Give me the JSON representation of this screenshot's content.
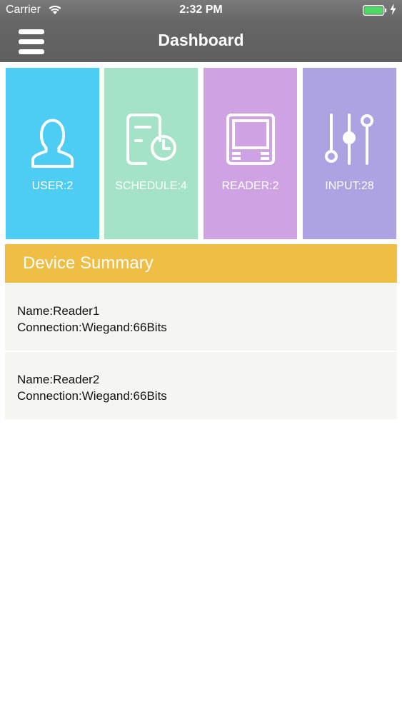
{
  "status_bar": {
    "carrier": "Carrier",
    "time": "2:32 PM",
    "battery_color": "#4cd964"
  },
  "header": {
    "title": "Dashboard",
    "menu_icon": "hamburger-menu-icon"
  },
  "tiles": [
    {
      "label": "USER:2",
      "icon": "user-icon",
      "color": "#4dcdf3"
    },
    {
      "label": "SCHEDULE:4",
      "icon": "schedule-icon",
      "color": "#a5e3c9"
    },
    {
      "label": "READER:2",
      "icon": "reader-icon",
      "color": "#cfa3e3"
    },
    {
      "label": "INPUT:28",
      "icon": "sliders-icon",
      "color": "#ada3e3"
    }
  ],
  "device_summary": {
    "title": "Device Summary",
    "header_color": "#f0be45",
    "devices": [
      {
        "name": "Name:Reader1",
        "connection": "Connection:Wiegand:66Bits"
      },
      {
        "name": "Name:Reader2",
        "connection": "Connection:Wiegand:66Bits"
      }
    ]
  }
}
